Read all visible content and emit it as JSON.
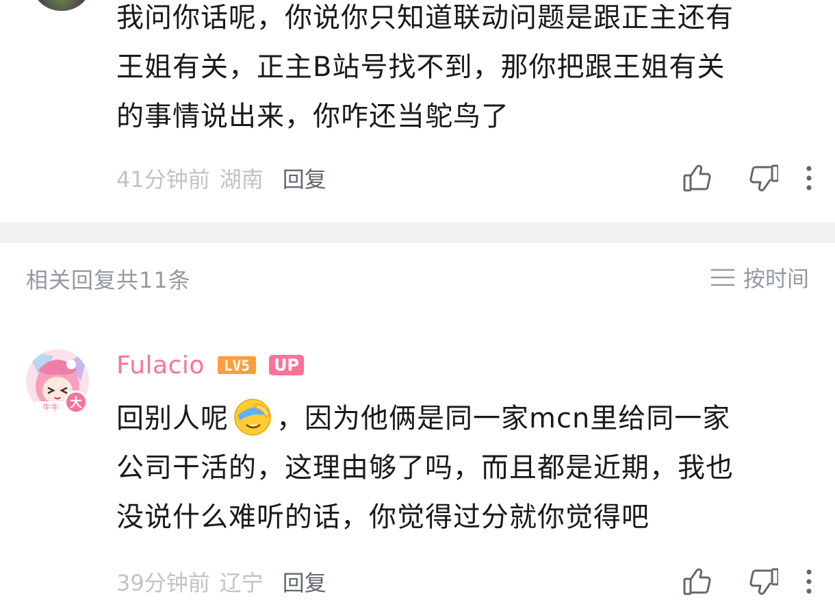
{
  "comment1": {
    "lines": [
      "我问你话呢，你说你只知道联动问题是跟正主还有",
      "王姐有关，正主B站号找不到，那你把跟王姐有关",
      "的事情说出来，你咋还当鸵鸟了"
    ],
    "time": "41分钟前",
    "location": "湖南",
    "reply_label": "回复"
  },
  "replies_header": {
    "count_text": "相关回复共11条",
    "sort_label": "按时间"
  },
  "comment2": {
    "username": "Fulacio",
    "level": "LV5",
    "up_badge": "UP",
    "avatar_badge": "大",
    "line1_before": "回别人呢",
    "line1_after": "，因为他俩是同一家mcn里给同一家",
    "emoji": "facepalm-emoji",
    "lines": [
      "公司干活的，这理由够了吗，而且都是近期，我也",
      "没说什么难听的话，你觉得过分就你觉得吧"
    ],
    "time": "39分钟前",
    "location": "辽宁",
    "reply_label": "回复"
  },
  "colors": {
    "username_pink": "#fb7299",
    "level_orange": "#ff9e3d",
    "meta_gray": "#c0c3c7",
    "separator": "#f1f2f3"
  }
}
